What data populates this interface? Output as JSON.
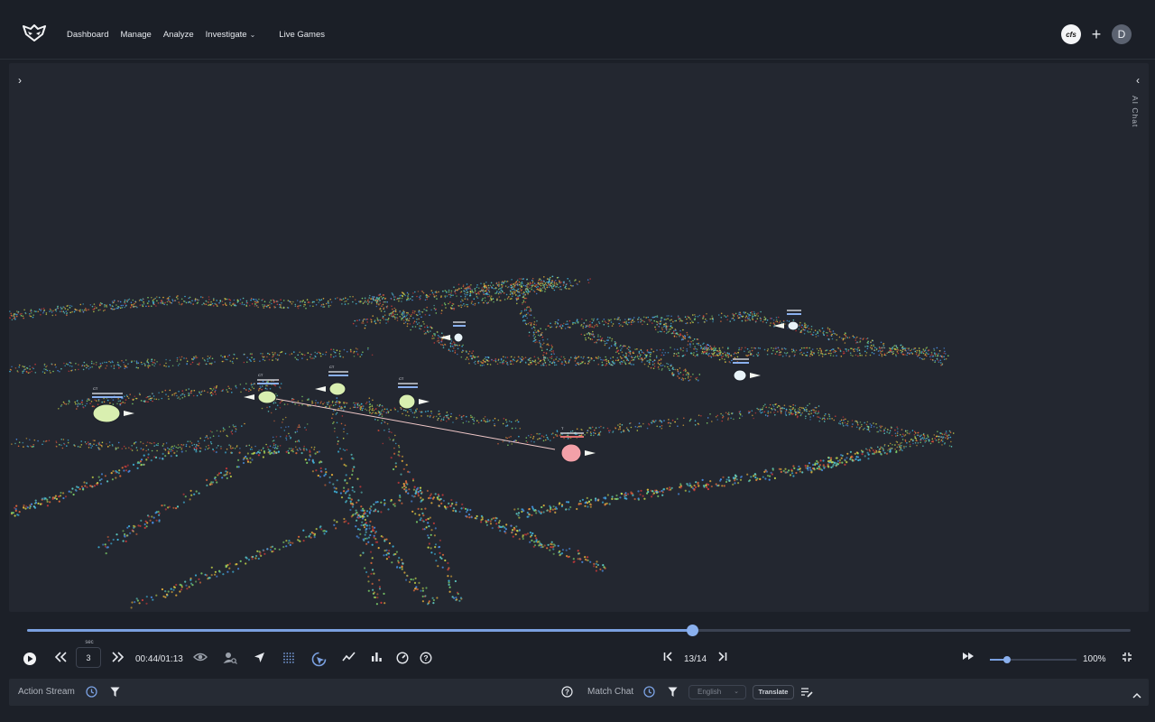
{
  "nav": {
    "items": [
      "Dashboard",
      "Manage",
      "Analyze",
      "Investigate",
      "Live Games"
    ],
    "dropdown_index": 3
  },
  "header": {
    "badge": "cfs",
    "avatar_initial": "D"
  },
  "side_panel": {
    "label": "AI Chat"
  },
  "players": [
    {
      "team": "ct",
      "tag": "CT"
    },
    {
      "team": "ct",
      "tag": "CT"
    },
    {
      "team": "ct",
      "tag": "CT"
    },
    {
      "team": "ct",
      "tag": "CT"
    },
    {
      "team": "ct",
      "tag": ""
    },
    {
      "team": "ct",
      "tag": ""
    },
    {
      "team": "ct",
      "tag": ""
    },
    {
      "team": "t",
      "tag": "T"
    }
  ],
  "timeline": {
    "progress": 0.603
  },
  "controls": {
    "sec_label": "sec",
    "sec_value": "3",
    "time": "00:44/01:13",
    "round": "13/14",
    "zoom": "100%",
    "zoom_level": 0.2
  },
  "bottom_bar": {
    "action_stream": "Action Stream",
    "match_chat": "Match Chat",
    "language": "English",
    "translate": "Translate"
  },
  "colors": {
    "accent": "#7aa0e0",
    "ct_player": "#d9efb0",
    "t_player": "#f2a0a8",
    "background": "#1c2028"
  }
}
